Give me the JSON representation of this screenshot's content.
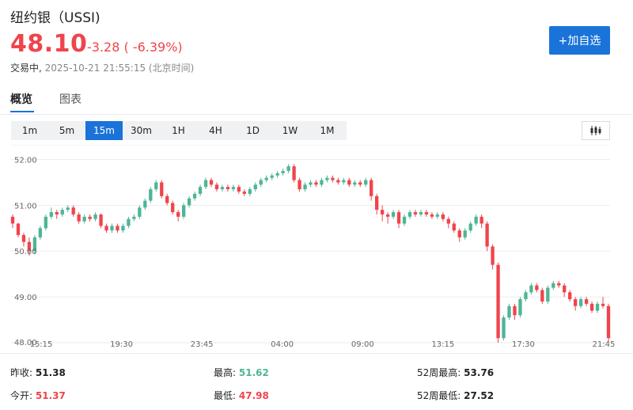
{
  "header": {
    "title": "纽约银（USSI)",
    "price": "48.10",
    "change": "-3.28 ( -6.39%)",
    "status_label": "交易中,",
    "status_time": "2025-10-21 21:55:15 (北京时间)",
    "follow_label": "+加自选"
  },
  "tabs": [
    {
      "label": "概览",
      "active": true
    },
    {
      "label": "图表",
      "active": false
    }
  ],
  "intervals": [
    {
      "label": "1m",
      "active": false
    },
    {
      "label": "5m",
      "active": false
    },
    {
      "label": "15m",
      "active": true
    },
    {
      "label": "30m",
      "active": false
    },
    {
      "label": "1H",
      "active": false
    },
    {
      "label": "4H",
      "active": false
    },
    {
      "label": "1D",
      "active": false
    },
    {
      "label": "1W",
      "active": false
    },
    {
      "label": "1M",
      "active": false
    }
  ],
  "chart_type_icon": "candlestick-icon",
  "colors": {
    "up": "#4db598",
    "down": "#f0444b",
    "accent": "#1a73d9"
  },
  "stats": {
    "prev_close_label": "昨收:",
    "prev_close": "51.38",
    "open_label": "今开:",
    "open": "51.37",
    "high_label": "最高:",
    "high": "51.62",
    "low_label": "最低:",
    "low": "47.98",
    "high52_label": "52周最高:",
    "high52": "53.76",
    "low52_label": "52周最低:",
    "low52": "27.52"
  },
  "chart_data": {
    "type": "candlestick",
    "y_ticks": [
      "52.00",
      "51.00",
      "50.00",
      "49.00",
      "48.00"
    ],
    "ylim": [
      48.0,
      52.25
    ],
    "x_ticks": [
      "15:15",
      "19:30",
      "23:45",
      "04:00",
      "09:00",
      "13:15",
      "17:30",
      "21:45"
    ],
    "grid": true,
    "candles": [
      [
        50.75,
        50.6,
        50.8,
        50.5
      ],
      [
        50.6,
        50.35,
        50.62,
        50.3
      ],
      [
        50.35,
        50.2,
        50.4,
        50.1
      ],
      [
        50.2,
        50.0,
        50.3,
        49.9
      ],
      [
        50.0,
        50.3,
        50.35,
        49.95
      ],
      [
        50.3,
        50.5,
        50.55,
        50.25
      ],
      [
        50.5,
        50.75,
        50.8,
        50.45
      ],
      [
        50.75,
        50.85,
        50.95,
        50.7
      ],
      [
        50.85,
        50.8,
        50.9,
        50.7
      ],
      [
        50.8,
        50.9,
        50.95,
        50.75
      ],
      [
        50.9,
        50.95,
        51.0,
        50.85
      ],
      [
        50.95,
        50.8,
        51.0,
        50.75
      ],
      [
        50.8,
        50.65,
        50.85,
        50.6
      ],
      [
        50.65,
        50.75,
        50.8,
        50.6
      ],
      [
        50.75,
        50.7,
        50.8,
        50.65
      ],
      [
        50.7,
        50.8,
        50.85,
        50.65
      ],
      [
        50.8,
        50.55,
        50.82,
        50.5
      ],
      [
        50.55,
        50.45,
        50.6,
        50.4
      ],
      [
        50.45,
        50.55,
        50.6,
        50.4
      ],
      [
        50.55,
        50.45,
        50.6,
        50.4
      ],
      [
        50.45,
        50.55,
        50.6,
        50.4
      ],
      [
        50.55,
        50.7,
        50.75,
        50.5
      ],
      [
        50.7,
        50.75,
        50.8,
        50.65
      ],
      [
        50.75,
        50.95,
        51.0,
        50.7
      ],
      [
        50.95,
        51.1,
        51.15,
        50.9
      ],
      [
        51.1,
        51.35,
        51.4,
        51.05
      ],
      [
        51.35,
        51.5,
        51.55,
        51.3
      ],
      [
        51.5,
        51.2,
        51.55,
        51.15
      ],
      [
        51.2,
        51.05,
        51.25,
        51.0
      ],
      [
        51.05,
        50.85,
        51.1,
        50.8
      ],
      [
        50.85,
        50.75,
        50.9,
        50.65
      ],
      [
        50.75,
        51.0,
        51.05,
        50.7
      ],
      [
        51.0,
        51.15,
        51.2,
        50.95
      ],
      [
        51.15,
        51.25,
        51.3,
        51.1
      ],
      [
        51.25,
        51.4,
        51.45,
        51.2
      ],
      [
        51.4,
        51.55,
        51.6,
        51.35
      ],
      [
        51.55,
        51.45,
        51.6,
        51.4
      ],
      [
        51.45,
        51.35,
        51.5,
        51.3
      ],
      [
        51.35,
        51.4,
        51.45,
        51.3
      ],
      [
        51.4,
        51.35,
        51.45,
        51.3
      ],
      [
        51.35,
        51.4,
        51.45,
        51.3
      ],
      [
        51.4,
        51.3,
        51.45,
        51.25
      ],
      [
        51.3,
        51.25,
        51.35,
        51.2
      ],
      [
        51.25,
        51.35,
        51.4,
        51.2
      ],
      [
        51.35,
        51.45,
        51.5,
        51.3
      ],
      [
        51.45,
        51.55,
        51.6,
        51.4
      ],
      [
        51.55,
        51.6,
        51.65,
        51.5
      ],
      [
        51.6,
        51.65,
        51.7,
        51.55
      ],
      [
        51.65,
        51.7,
        51.75,
        51.6
      ],
      [
        51.7,
        51.75,
        51.8,
        51.65
      ],
      [
        51.75,
        51.85,
        51.9,
        51.7
      ],
      [
        51.85,
        51.55,
        51.9,
        51.5
      ],
      [
        51.55,
        51.35,
        51.6,
        51.3
      ],
      [
        51.35,
        51.45,
        51.5,
        51.3
      ],
      [
        51.45,
        51.5,
        51.55,
        51.4
      ],
      [
        51.5,
        51.45,
        51.55,
        51.4
      ],
      [
        51.45,
        51.55,
        51.6,
        51.4
      ],
      [
        51.55,
        51.6,
        51.65,
        51.5
      ],
      [
        51.6,
        51.55,
        51.65,
        51.5
      ],
      [
        51.55,
        51.5,
        51.6,
        51.45
      ],
      [
        51.5,
        51.55,
        51.6,
        51.45
      ],
      [
        51.55,
        51.45,
        51.6,
        51.4
      ],
      [
        51.45,
        51.5,
        51.55,
        51.4
      ],
      [
        51.5,
        51.45,
        51.55,
        51.4
      ],
      [
        51.45,
        51.55,
        51.6,
        51.4
      ],
      [
        51.55,
        51.2,
        51.6,
        51.1
      ],
      [
        51.2,
        50.9,
        51.25,
        50.8
      ],
      [
        50.9,
        50.8,
        51.0,
        50.65
      ],
      [
        50.8,
        50.75,
        50.85,
        50.6
      ],
      [
        50.75,
        50.85,
        50.9,
        50.7
      ],
      [
        50.85,
        50.6,
        50.9,
        50.5
      ],
      [
        50.6,
        50.75,
        50.8,
        50.55
      ],
      [
        50.75,
        50.85,
        50.9,
        50.7
      ],
      [
        50.85,
        50.8,
        50.9,
        50.75
      ],
      [
        50.8,
        50.85,
        50.9,
        50.75
      ],
      [
        50.85,
        50.8,
        50.9,
        50.75
      ],
      [
        50.8,
        50.75,
        50.85,
        50.7
      ],
      [
        50.75,
        50.8,
        50.85,
        50.7
      ],
      [
        50.8,
        50.7,
        50.85,
        50.65
      ],
      [
        50.7,
        50.6,
        50.75,
        50.5
      ],
      [
        50.6,
        50.45,
        50.65,
        50.4
      ],
      [
        50.45,
        50.3,
        50.5,
        50.2
      ],
      [
        50.3,
        50.45,
        50.5,
        50.25
      ],
      [
        50.45,
        50.6,
        50.65,
        50.4
      ],
      [
        50.6,
        50.75,
        50.8,
        50.55
      ],
      [
        50.75,
        50.6,
        50.8,
        50.5
      ],
      [
        50.6,
        50.1,
        50.65,
        50.0
      ],
      [
        50.1,
        49.7,
        50.15,
        49.6
      ],
      [
        49.7,
        48.1,
        49.75,
        48.0
      ],
      [
        48.1,
        48.55,
        48.6,
        48.05
      ],
      [
        48.55,
        48.8,
        48.85,
        48.5
      ],
      [
        48.8,
        48.6,
        48.85,
        48.5
      ],
      [
        48.6,
        48.95,
        49.0,
        48.55
      ],
      [
        48.95,
        49.1,
        49.15,
        48.9
      ],
      [
        49.1,
        49.25,
        49.3,
        49.05
      ],
      [
        49.25,
        49.15,
        49.3,
        49.1
      ],
      [
        49.15,
        48.9,
        49.2,
        48.85
      ],
      [
        48.9,
        49.2,
        49.25,
        48.85
      ],
      [
        49.2,
        49.3,
        49.35,
        49.15
      ],
      [
        49.3,
        49.25,
        49.35,
        49.2
      ],
      [
        49.25,
        49.1,
        49.3,
        49.0
      ],
      [
        49.1,
        48.95,
        49.15,
        48.9
      ],
      [
        48.95,
        48.8,
        49.0,
        48.7
      ],
      [
        48.8,
        48.95,
        49.0,
        48.75
      ],
      [
        48.95,
        48.85,
        49.0,
        48.8
      ],
      [
        48.85,
        48.7,
        48.9,
        48.65
      ],
      [
        48.7,
        48.85,
        48.9,
        48.65
      ],
      [
        48.85,
        48.8,
        49.0,
        48.75
      ],
      [
        48.8,
        48.1,
        48.85,
        48.0
      ]
    ]
  }
}
